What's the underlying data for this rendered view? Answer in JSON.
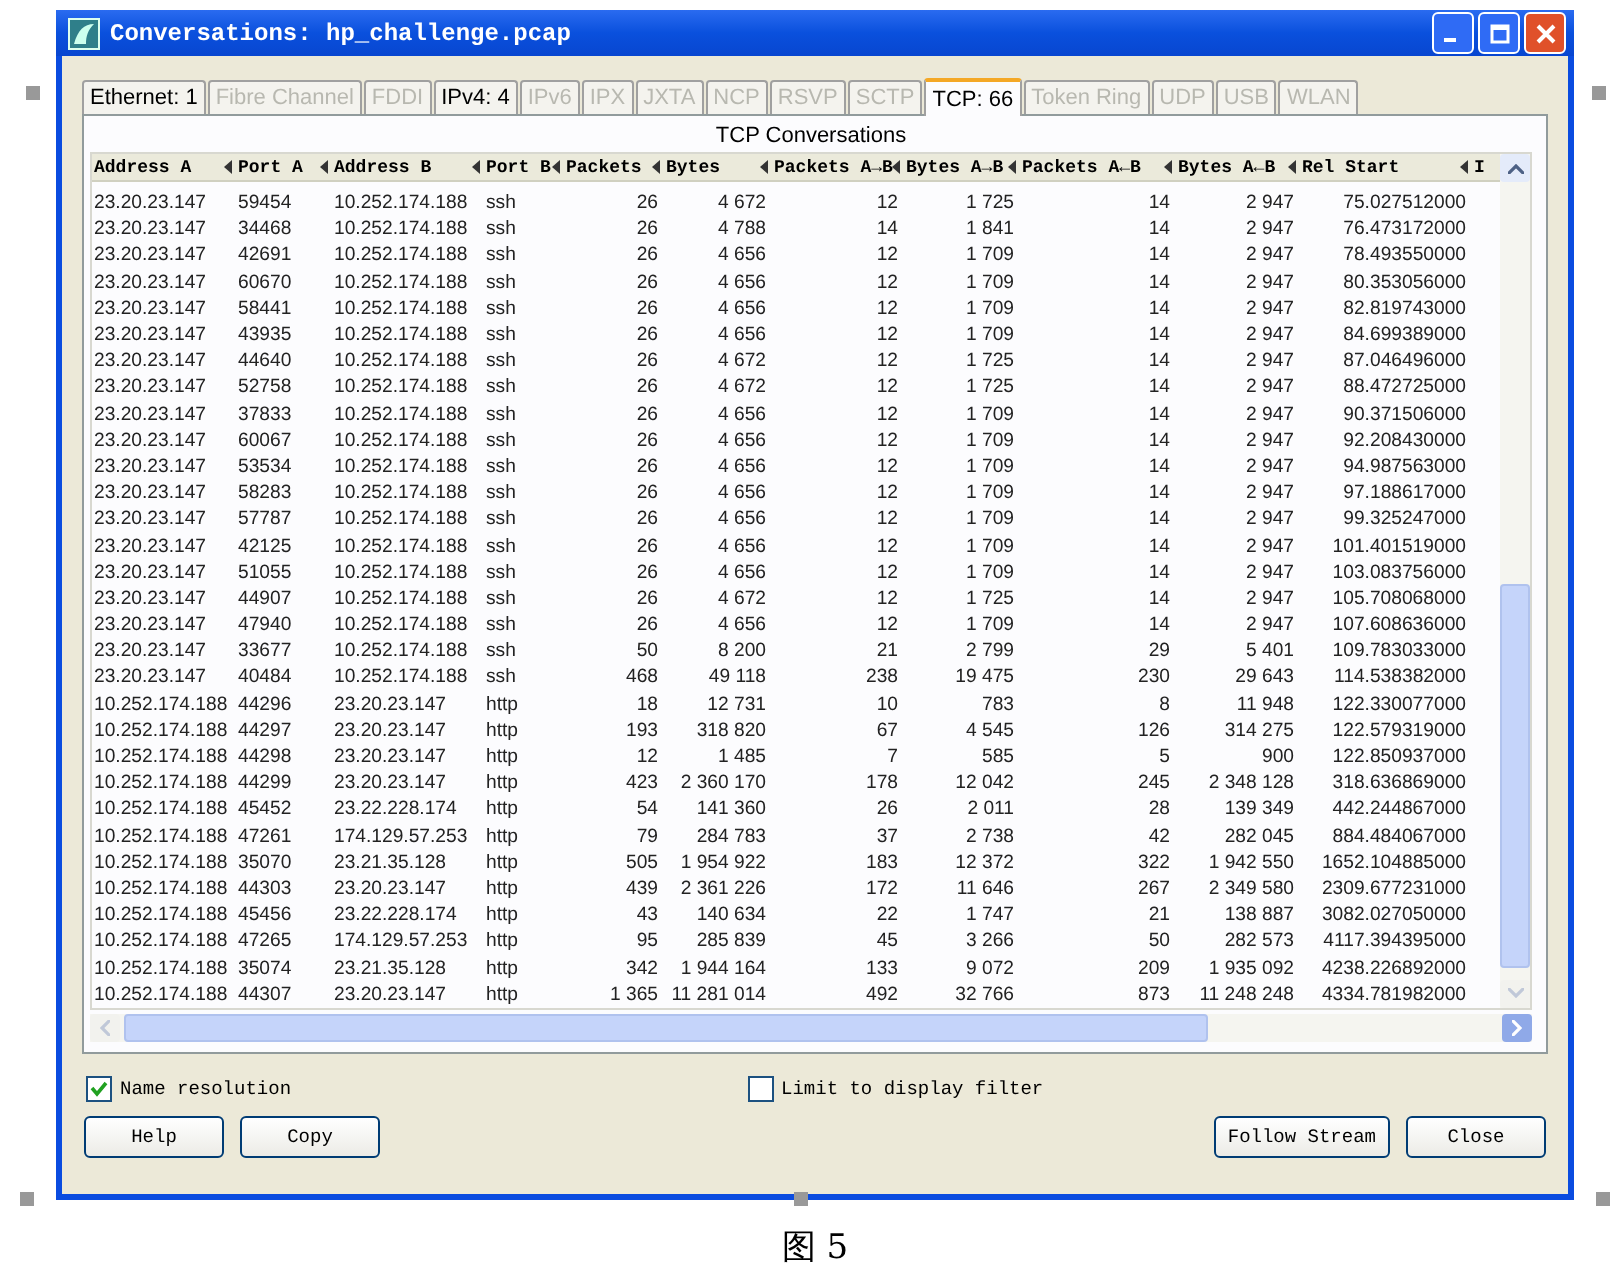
{
  "window": {
    "title": "Conversations: hp_challenge.pcap"
  },
  "tabs": [
    {
      "label": "Ethernet: 1",
      "selected": false,
      "disabled": false
    },
    {
      "label": "Fibre Channel",
      "selected": false,
      "disabled": true
    },
    {
      "label": "FDDI",
      "selected": false,
      "disabled": true
    },
    {
      "label": "IPv4: 4",
      "selected": false,
      "disabled": false
    },
    {
      "label": "IPv6",
      "selected": false,
      "disabled": true
    },
    {
      "label": "IPX",
      "selected": false,
      "disabled": true
    },
    {
      "label": "JXTA",
      "selected": false,
      "disabled": true
    },
    {
      "label": "NCP",
      "selected": false,
      "disabled": true
    },
    {
      "label": "RSVP",
      "selected": false,
      "disabled": true
    },
    {
      "label": "SCTP",
      "selected": false,
      "disabled": true
    },
    {
      "label": "TCP: 66",
      "selected": true,
      "disabled": false
    },
    {
      "label": "Token Ring",
      "selected": false,
      "disabled": true
    },
    {
      "label": "UDP",
      "selected": false,
      "disabled": true
    },
    {
      "label": "USB",
      "selected": false,
      "disabled": true
    },
    {
      "label": "WLAN",
      "selected": false,
      "disabled": true
    }
  ],
  "table": {
    "title": "TCP Conversations",
    "columns": [
      "Address A",
      "Port A",
      "Address B",
      "Port B",
      "Packets",
      "Bytes",
      "Packets A→B",
      "Bytes A→B",
      "Packets A←B",
      "Bytes A←B",
      "Rel Start",
      "I"
    ],
    "rows": [
      [
        "23.20.23.147",
        "59454",
        "10.252.174.188",
        "ssh",
        "26",
        "4 672",
        "12",
        "1 725",
        "14",
        "2 947",
        "75.027512000"
      ],
      [
        "23.20.23.147",
        "34468",
        "10.252.174.188",
        "ssh",
        "26",
        "4 788",
        "14",
        "1 841",
        "14",
        "2 947",
        "76.473172000"
      ],
      [
        "23.20.23.147",
        "42691",
        "10.252.174.188",
        "ssh",
        "26",
        "4 656",
        "12",
        "1 709",
        "14",
        "2 947",
        "78.493550000"
      ],
      [
        "23.20.23.147",
        "60670",
        "10.252.174.188",
        "ssh",
        "26",
        "4 656",
        "12",
        "1 709",
        "14",
        "2 947",
        "80.353056000"
      ],
      [
        "23.20.23.147",
        "58441",
        "10.252.174.188",
        "ssh",
        "26",
        "4 656",
        "12",
        "1 709",
        "14",
        "2 947",
        "82.819743000"
      ],
      [
        "23.20.23.147",
        "43935",
        "10.252.174.188",
        "ssh",
        "26",
        "4 656",
        "12",
        "1 709",
        "14",
        "2 947",
        "84.699389000"
      ],
      [
        "23.20.23.147",
        "44640",
        "10.252.174.188",
        "ssh",
        "26",
        "4 672",
        "12",
        "1 725",
        "14",
        "2 947",
        "87.046496000"
      ],
      [
        "23.20.23.147",
        "52758",
        "10.252.174.188",
        "ssh",
        "26",
        "4 672",
        "12",
        "1 725",
        "14",
        "2 947",
        "88.472725000"
      ],
      [
        "23.20.23.147",
        "37833",
        "10.252.174.188",
        "ssh",
        "26",
        "4 656",
        "12",
        "1 709",
        "14",
        "2 947",
        "90.371506000"
      ],
      [
        "23.20.23.147",
        "60067",
        "10.252.174.188",
        "ssh",
        "26",
        "4 656",
        "12",
        "1 709",
        "14",
        "2 947",
        "92.208430000"
      ],
      [
        "23.20.23.147",
        "53534",
        "10.252.174.188",
        "ssh",
        "26",
        "4 656",
        "12",
        "1 709",
        "14",
        "2 947",
        "94.987563000"
      ],
      [
        "23.20.23.147",
        "58283",
        "10.252.174.188",
        "ssh",
        "26",
        "4 656",
        "12",
        "1 709",
        "14",
        "2 947",
        "97.188617000"
      ],
      [
        "23.20.23.147",
        "57787",
        "10.252.174.188",
        "ssh",
        "26",
        "4 656",
        "12",
        "1 709",
        "14",
        "2 947",
        "99.325247000"
      ],
      [
        "23.20.23.147",
        "42125",
        "10.252.174.188",
        "ssh",
        "26",
        "4 656",
        "12",
        "1 709",
        "14",
        "2 947",
        "101.401519000"
      ],
      [
        "23.20.23.147",
        "51055",
        "10.252.174.188",
        "ssh",
        "26",
        "4 656",
        "12",
        "1 709",
        "14",
        "2 947",
        "103.083756000"
      ],
      [
        "23.20.23.147",
        "44907",
        "10.252.174.188",
        "ssh",
        "26",
        "4 672",
        "12",
        "1 725",
        "14",
        "2 947",
        "105.708068000"
      ],
      [
        "23.20.23.147",
        "47940",
        "10.252.174.188",
        "ssh",
        "26",
        "4 656",
        "12",
        "1 709",
        "14",
        "2 947",
        "107.608636000"
      ],
      [
        "23.20.23.147",
        "33677",
        "10.252.174.188",
        "ssh",
        "50",
        "8 200",
        "21",
        "2 799",
        "29",
        "5 401",
        "109.783033000"
      ],
      [
        "23.20.23.147",
        "40484",
        "10.252.174.188",
        "ssh",
        "468",
        "49 118",
        "238",
        "19 475",
        "230",
        "29 643",
        "114.538382000"
      ],
      [
        "10.252.174.188",
        "44296",
        "23.20.23.147",
        "http",
        "18",
        "12 731",
        "10",
        "783",
        "8",
        "11 948",
        "122.330077000"
      ],
      [
        "10.252.174.188",
        "44297",
        "23.20.23.147",
        "http",
        "193",
        "318 820",
        "67",
        "4 545",
        "126",
        "314 275",
        "122.579319000"
      ],
      [
        "10.252.174.188",
        "44298",
        "23.20.23.147",
        "http",
        "12",
        "1 485",
        "7",
        "585",
        "5",
        "900",
        "122.850937000"
      ],
      [
        "10.252.174.188",
        "44299",
        "23.20.23.147",
        "http",
        "423",
        "2 360 170",
        "178",
        "12 042",
        "245",
        "2 348 128",
        "318.636869000"
      ],
      [
        "10.252.174.188",
        "45452",
        "23.22.228.174",
        "http",
        "54",
        "141 360",
        "26",
        "2 011",
        "28",
        "139 349",
        "442.244867000"
      ],
      [
        "10.252.174.188",
        "47261",
        "174.129.57.253",
        "http",
        "79",
        "284 783",
        "37",
        "2 738",
        "42",
        "282 045",
        "884.484067000"
      ],
      [
        "10.252.174.188",
        "35070",
        "23.21.35.128",
        "http",
        "505",
        "1 954 922",
        "183",
        "12 372",
        "322",
        "1 942 550",
        "1652.104885000"
      ],
      [
        "10.252.174.188",
        "44303",
        "23.20.23.147",
        "http",
        "439",
        "2 361 226",
        "172",
        "11 646",
        "267",
        "2 349 580",
        "2309.677231000"
      ],
      [
        "10.252.174.188",
        "45456",
        "23.22.228.174",
        "http",
        "43",
        "140 634",
        "22",
        "1 747",
        "21",
        "138 887",
        "3082.027050000"
      ],
      [
        "10.252.174.188",
        "47265",
        "174.129.57.253",
        "http",
        "95",
        "285 839",
        "45",
        "3 266",
        "50",
        "282 573",
        "4117.394395000"
      ],
      [
        "10.252.174.188",
        "35074",
        "23.21.35.128",
        "http",
        "342",
        "1 944 164",
        "133",
        "9 072",
        "209",
        "1 935 092",
        "4238.226892000"
      ],
      [
        "10.252.174.188",
        "44307",
        "23.20.23.147",
        "http",
        "1 365",
        "11 281 014",
        "492",
        "32 766",
        "873",
        "11 248 248",
        "4334.781982000"
      ]
    ]
  },
  "options": [
    {
      "label": "Name resolution",
      "checked": true
    },
    {
      "label": "Limit to display filter",
      "checked": false
    }
  ],
  "buttons_left": [
    "Help",
    "Copy"
  ],
  "buttons_right": [
    "Follow Stream",
    "Close"
  ],
  "caption": "图 5"
}
